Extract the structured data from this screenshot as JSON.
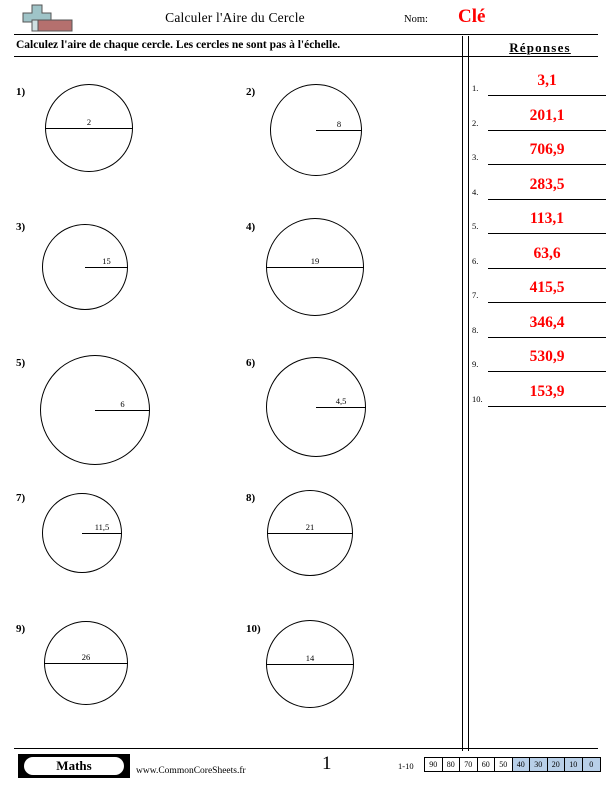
{
  "header": {
    "title": "Calculer l'Aire du Cercle",
    "name_label": "Nom:",
    "name_value": "Clé",
    "logo_icon": "plus-block-logo"
  },
  "instructions": {
    "text": "Calculez l'aire de chaque cercle. Les cercles ne sont pas à l'échelle."
  },
  "answers": {
    "title": "Réponses",
    "items": [
      {
        "num": "1.",
        "value": "3,1"
      },
      {
        "num": "2.",
        "value": "201,1"
      },
      {
        "num": "3.",
        "value": "706,9"
      },
      {
        "num": "4.",
        "value": "283,5"
      },
      {
        "num": "5.",
        "value": "113,1"
      },
      {
        "num": "6.",
        "value": "63,6"
      },
      {
        "num": "7.",
        "value": "415,5"
      },
      {
        "num": "8.",
        "value": "346,4"
      },
      {
        "num": "9.",
        "value": "530,9"
      },
      {
        "num": "10.",
        "value": "153,9"
      }
    ]
  },
  "problems": [
    {
      "num": "1)",
      "measure": "2",
      "type": "diameter"
    },
    {
      "num": "2)",
      "measure": "8",
      "type": "radius"
    },
    {
      "num": "3)",
      "measure": "15",
      "type": "radius"
    },
    {
      "num": "4)",
      "measure": "19",
      "type": "diameter"
    },
    {
      "num": "5)",
      "measure": "6",
      "type": "radius"
    },
    {
      "num": "6)",
      "measure": "4,5",
      "type": "radius"
    },
    {
      "num": "7)",
      "measure": "11,5",
      "type": "radius"
    },
    {
      "num": "8)",
      "measure": "21",
      "type": "diameter"
    },
    {
      "num": "9)",
      "measure": "26",
      "type": "diameter"
    },
    {
      "num": "10)",
      "measure": "14",
      "type": "diameter"
    }
  ],
  "footer": {
    "brand": "Maths",
    "url": "www.CommonCoreSheets.fr",
    "page": "1",
    "scale_label": "1-10",
    "scale_cells": [
      {
        "value": "90",
        "highlighted": false
      },
      {
        "value": "80",
        "highlighted": false
      },
      {
        "value": "70",
        "highlighted": false
      },
      {
        "value": "60",
        "highlighted": false
      },
      {
        "value": "50",
        "highlighted": false
      },
      {
        "value": "40",
        "highlighted": true
      },
      {
        "value": "30",
        "highlighted": true
      },
      {
        "value": "20",
        "highlighted": true
      },
      {
        "value": "10",
        "highlighted": true
      },
      {
        "value": "0",
        "highlighted": true
      }
    ]
  },
  "colors": {
    "answer_red": "#ff0000",
    "scale_highlight": "#b8cfe8",
    "logo_cross": "#9fc4c8",
    "logo_block": "#b5706e"
  }
}
